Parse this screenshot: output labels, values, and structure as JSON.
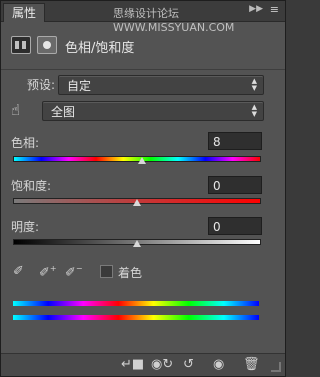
{
  "panel": {
    "tab_label": "属性",
    "watermark": "思缘设计论坛 WWW.MISSYUAN.COM",
    "title": "色相/饱和度"
  },
  "preset": {
    "label": "预设:",
    "value": "自定"
  },
  "channel": {
    "value": "全图"
  },
  "hue": {
    "label": "色相:",
    "value": "8",
    "slider_fraction": 0.52
  },
  "saturation": {
    "label": "饱和度:",
    "value": "0",
    "slider_fraction": 0.5
  },
  "lightness": {
    "label": "明度:",
    "value": "0",
    "slider_fraction": 0.5
  },
  "colorize": {
    "label": "着色",
    "checked": false
  },
  "icons": {
    "menu": "menu-icon",
    "collapse": "collapse-icon",
    "hand": "targeted-adjustment-hand-icon",
    "eyedropper": "eyedropper-icon",
    "eyedropper_add": "eyedropper-plus-icon",
    "eyedropper_sub": "eyedropper-minus-icon",
    "clip": "clip-to-layer-icon",
    "view_previous": "view-previous-icon",
    "reset": "reset-icon",
    "visibility": "eye-icon",
    "trash": "trash-icon"
  },
  "colors": {
    "panel_bg": "#535353",
    "field_bg": "#2f2f2f",
    "text": "#d6d6d6"
  }
}
